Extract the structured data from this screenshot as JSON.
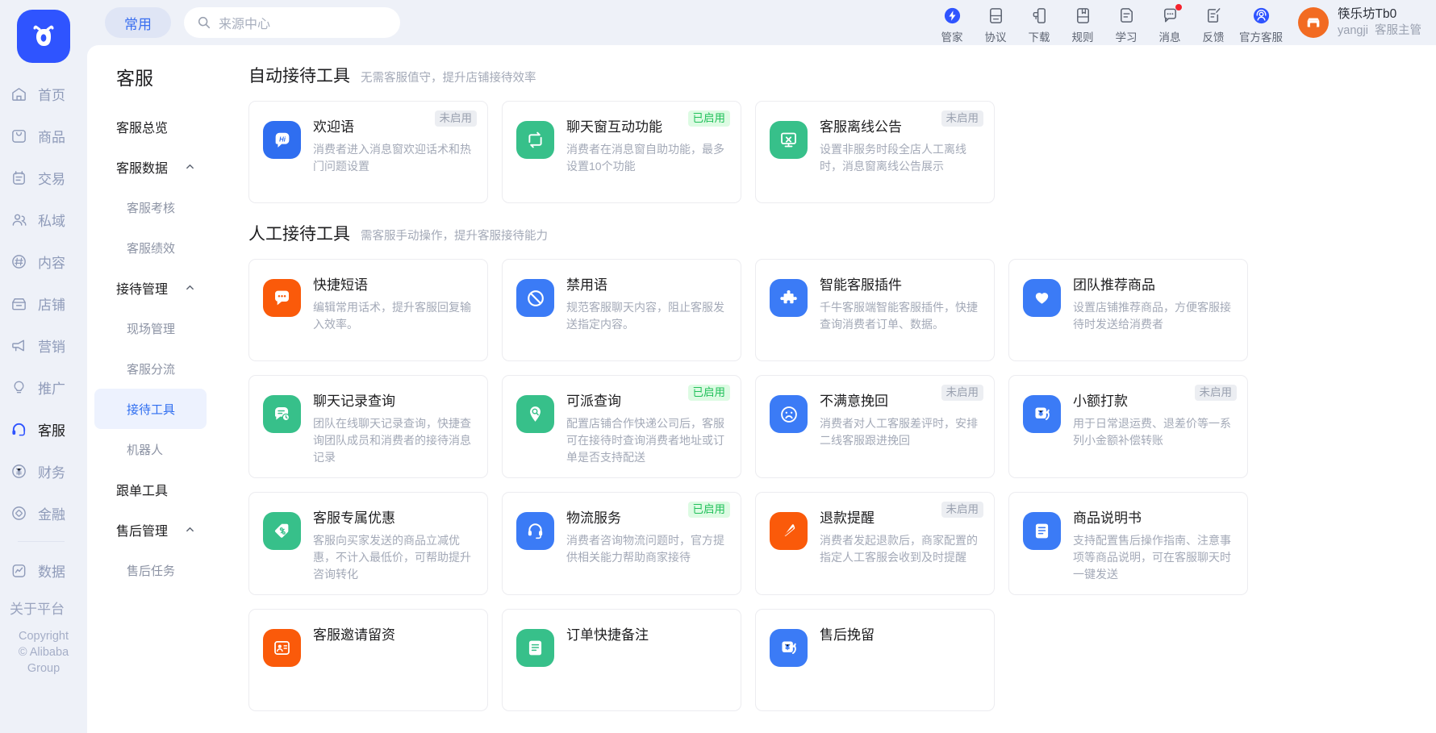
{
  "header": {
    "pill_label": "常用",
    "search_placeholder": "来源中心",
    "search_value": "",
    "tools": [
      {
        "label": "管家",
        "icon": "lightning-badge-icon",
        "badge": false
      },
      {
        "label": "协议",
        "icon": "document-agreement-icon",
        "badge": false
      },
      {
        "label": "下载",
        "icon": "download-panel-icon",
        "badge": false
      },
      {
        "label": "规则",
        "icon": "rules-book-icon",
        "badge": false
      },
      {
        "label": "学习",
        "icon": "study-doc-icon",
        "badge": false
      },
      {
        "label": "消息",
        "icon": "message-bubble-icon",
        "badge": true
      },
      {
        "label": "反馈",
        "icon": "feedback-edit-icon",
        "badge": false
      },
      {
        "label": "官方客服",
        "icon": "official-support-icon",
        "badge": false
      }
    ],
    "profile": {
      "shop_name": "筷乐坊Tb0",
      "user_id": "yangji",
      "role": "客服主管",
      "avatar_icon": "shop-avatar-icon"
    }
  },
  "rail": {
    "logo_icon": "ox-head-logo-icon",
    "items": [
      {
        "label": "首页",
        "icon": "home-icon",
        "active": false
      },
      {
        "label": "商品",
        "icon": "product-icon",
        "active": false
      },
      {
        "label": "交易",
        "icon": "transaction-icon",
        "active": false
      },
      {
        "label": "私域",
        "icon": "private-domain-icon",
        "active": false
      },
      {
        "label": "内容",
        "icon": "content-hash-icon",
        "active": false
      },
      {
        "label": "店铺",
        "icon": "shop-icon",
        "active": false
      },
      {
        "label": "营销",
        "icon": "marketing-megaphone-icon",
        "active": false
      },
      {
        "label": "推广",
        "icon": "promotion-bulb-icon",
        "active": false
      },
      {
        "label": "客服",
        "icon": "headset-icon",
        "active": true
      },
      {
        "label": "财务",
        "icon": "finance-yen-icon",
        "active": false
      },
      {
        "label": "金融",
        "icon": "fund-diamond-icon",
        "active": false
      }
    ],
    "items_after_sep": [
      {
        "label": "数据",
        "icon": "data-chart-icon",
        "active": false
      }
    ],
    "about_label": "关于平台",
    "copyright_lines": [
      "Copyright",
      "© Alibaba",
      "Group"
    ]
  },
  "subnav": {
    "title": "客服",
    "items": [
      {
        "label": "客服总览",
        "type": "top",
        "expanded": null,
        "selected": false
      },
      {
        "label": "客服数据",
        "type": "group",
        "expanded": true,
        "selected": false
      },
      {
        "label": "客服考核",
        "type": "child",
        "selected": false
      },
      {
        "label": "客服绩效",
        "type": "child",
        "selected": false
      },
      {
        "label": "接待管理",
        "type": "group",
        "expanded": true,
        "selected": false
      },
      {
        "label": "现场管理",
        "type": "child",
        "selected": false
      },
      {
        "label": "客服分流",
        "type": "child",
        "selected": false
      },
      {
        "label": "接待工具",
        "type": "child",
        "selected": true
      },
      {
        "label": "机器人",
        "type": "child",
        "selected": false
      },
      {
        "label": "跟单工具",
        "type": "top",
        "expanded": null,
        "selected": false
      },
      {
        "label": "售后管理",
        "type": "group",
        "expanded": true,
        "selected": false
      },
      {
        "label": "售后任务",
        "type": "child",
        "selected": false
      }
    ]
  },
  "sections": [
    {
      "title": "自动接待工具",
      "subtitle": "无需客服值守，提升店铺接待效率",
      "cards": [
        {
          "title": "欢迎语",
          "desc": "消费者进入消息窗欢迎话术和热门问题设置",
          "badge": "未启用",
          "badge_state": "off",
          "icon": "hi-bubble-icon",
          "icon_color": "#2f6ef0"
        },
        {
          "title": "聊天窗互动功能",
          "desc": "消费者在消息窗自助功能，最多设置10个功能",
          "badge": "已启用",
          "badge_state": "on",
          "icon": "loop-arrows-icon",
          "icon_color": "#37c08a"
        },
        {
          "title": "客服离线公告",
          "desc": "设置非服务时段全店人工离线时，消息窗离线公告展示",
          "badge": "未启用",
          "badge_state": "off",
          "icon": "monitor-x-icon",
          "icon_color": "#37c08a"
        }
      ]
    },
    {
      "title": "人工接待工具",
      "subtitle": "需客服手动操作，提升客服接待能力",
      "cards": [
        {
          "title": "快捷短语",
          "desc": "编辑常用话术，提升客服回复输入效率。",
          "badge": "",
          "badge_state": "none",
          "icon": "quick-phrase-bubble-icon",
          "icon_color": "#fa5a0a"
        },
        {
          "title": "禁用语",
          "desc": "规范客服聊天内容，阻止客服发送指定内容。",
          "badge": "",
          "badge_state": "none",
          "icon": "forbidden-icon",
          "icon_color": "#3b7bf6"
        },
        {
          "title": "智能客服插件",
          "desc": "千牛客服端智能客服插件，快捷查询消费者订单、数据。",
          "badge": "",
          "badge_state": "none",
          "icon": "puzzle-icon",
          "icon_color": "#3b7bf6"
        },
        {
          "title": "团队推荐商品",
          "desc": "设置店铺推荐商品，方便客服接待时发送给消费者",
          "badge": "",
          "badge_state": "none",
          "icon": "heart-icon",
          "icon_color": "#3b7bf6"
        },
        {
          "title": "聊天记录查询",
          "desc": "团队在线聊天记录查询，快捷查询团队成员和消费者的接待消息记录",
          "badge": "",
          "badge_state": "none",
          "icon": "chat-history-icon",
          "icon_color": "#37c08a"
        },
        {
          "title": "可派查询",
          "desc": "配置店铺合作快递公司后，客服可在接待时查询消费者地址或订单是否支持配送",
          "badge": "已启用",
          "badge_state": "on",
          "icon": "location-search-icon",
          "icon_color": "#37c08a"
        },
        {
          "title": "不满意挽回",
          "desc": "消费者对人工客服差评时，安排二线客服跟进挽回",
          "badge": "未启用",
          "badge_state": "off",
          "icon": "sad-face-icon",
          "icon_color": "#3b7bf6"
        },
        {
          "title": "小额打款",
          "desc": "用于日常退运费、退差价等一系列小金额补偿转账",
          "badge": "未启用",
          "badge_state": "off",
          "icon": "refund-yen-icon",
          "icon_color": "#3b7bf6"
        },
        {
          "title": "客服专属优惠",
          "desc": "客服向买家发送的商品立减优惠，不计入最低价，可帮助提升咨询转化",
          "badge": "",
          "badge_state": "none",
          "icon": "discount-tag-icon",
          "icon_color": "#37c08a"
        },
        {
          "title": "物流服务",
          "desc": "消费者咨询物流问题时，官方提供相关能力帮助商家接待",
          "badge": "已启用",
          "badge_state": "on",
          "icon": "logistics-headset-icon",
          "icon_color": "#3b7bf6"
        },
        {
          "title": "退款提醒",
          "desc": "消费者发起退款后，商家配置的指定人工客服会收到及时提醒",
          "badge": "未启用",
          "badge_state": "off",
          "icon": "refund-alert-icon",
          "icon_color": "#fa5a0a"
        },
        {
          "title": "商品说明书",
          "desc": "支持配置售后操作指南、注意事项等商品说明，可在客服聊天时一键发送",
          "badge": "",
          "badge_state": "none",
          "icon": "manual-doc-icon",
          "icon_color": "#3b7bf6"
        },
        {
          "title": "客服邀请留资",
          "desc": "",
          "badge": "",
          "badge_state": "none",
          "icon": "invite-card-icon",
          "icon_color": "#fa5a0a"
        },
        {
          "title": "订单快捷备注",
          "desc": "",
          "badge": "",
          "badge_state": "none",
          "icon": "order-note-icon",
          "icon_color": "#37c08a"
        },
        {
          "title": "售后挽留",
          "desc": "",
          "badge": "",
          "badge_state": "none",
          "icon": "aftersale-retain-icon",
          "icon_color": "#3b7bf6"
        }
      ]
    }
  ]
}
